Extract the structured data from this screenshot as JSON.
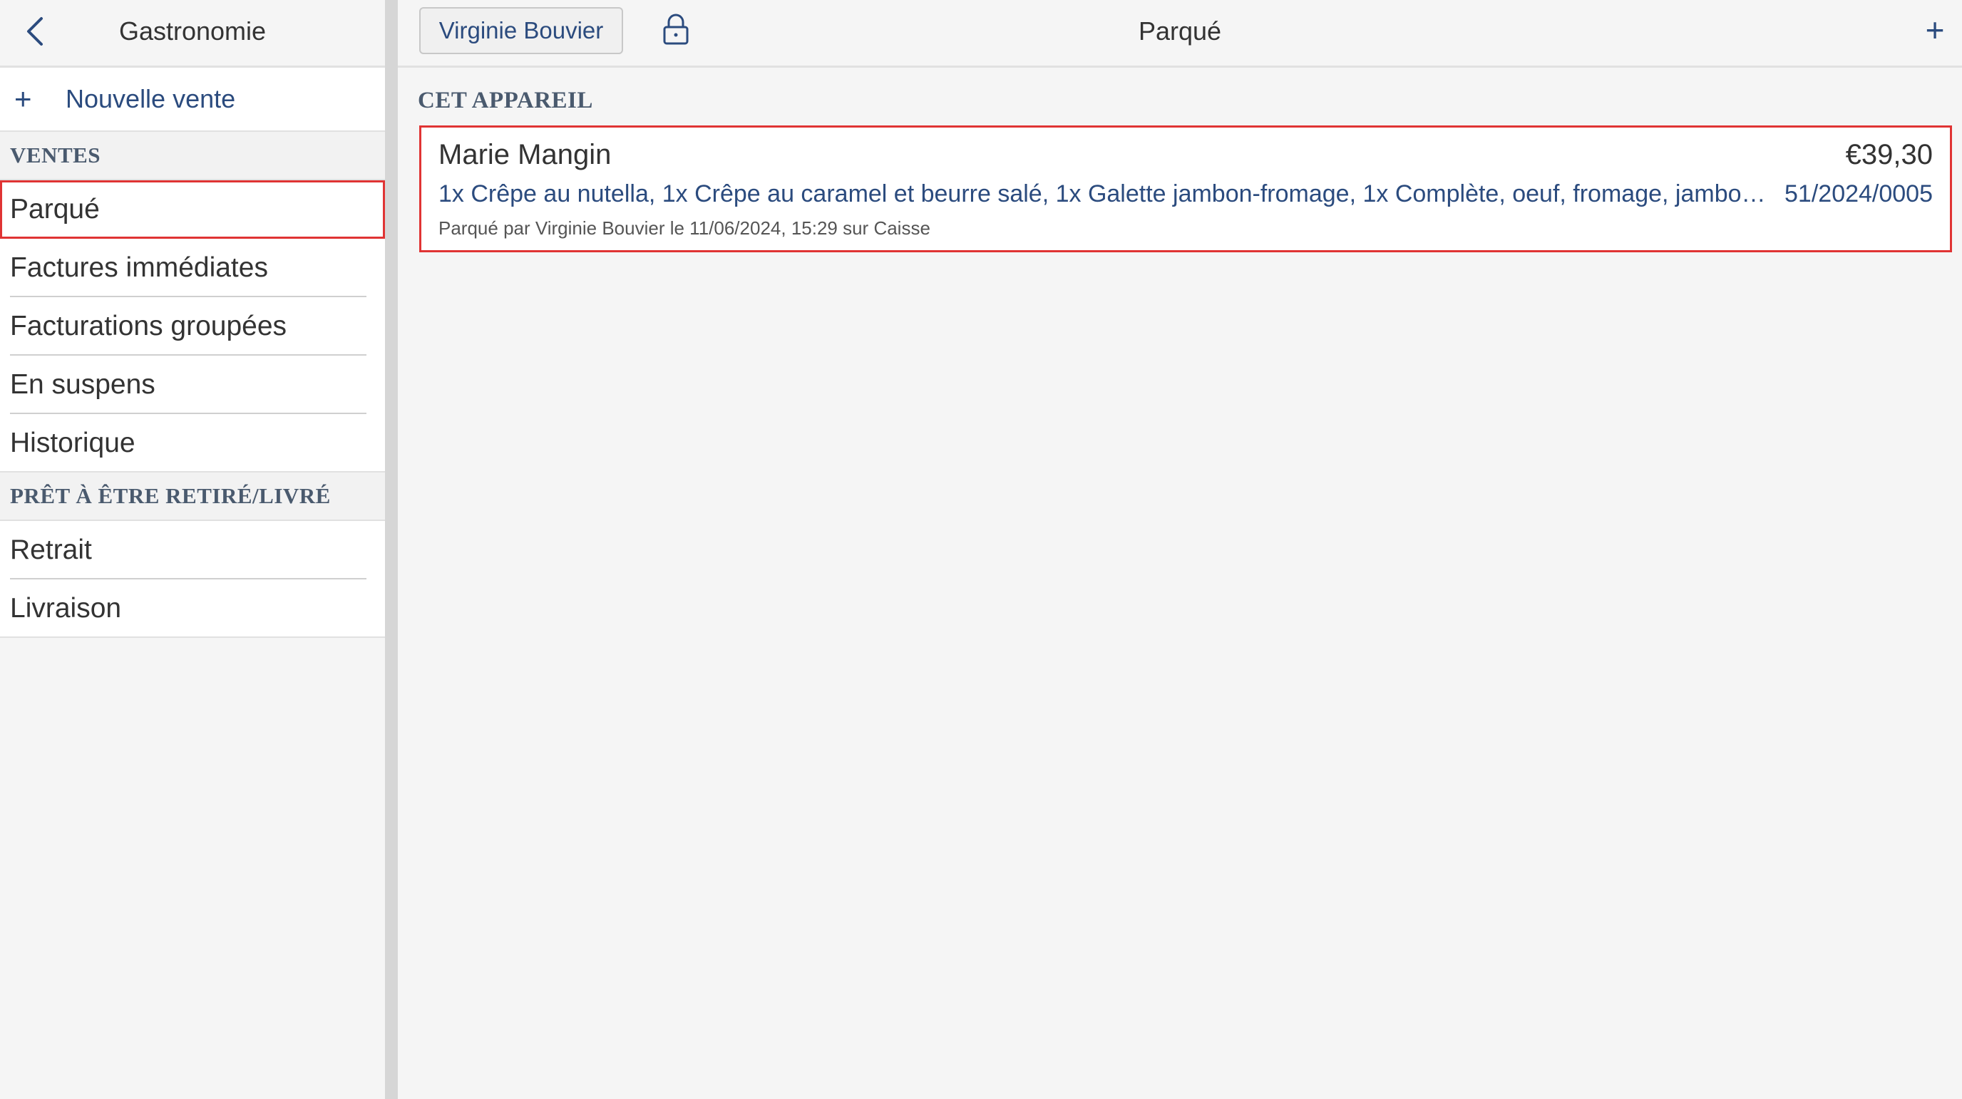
{
  "sidebar": {
    "title": "Gastronomie",
    "new_sale_label": "Nouvelle vente",
    "sections": [
      {
        "header": "VENTES",
        "items": [
          {
            "label": "Parqué",
            "active": true
          },
          {
            "label": "Factures immédiates"
          },
          {
            "label": "Facturations groupées"
          },
          {
            "label": "En suspens"
          },
          {
            "label": "Historique"
          }
        ]
      },
      {
        "header": "PRÊT À ÊTRE RETIRÉ/LIVRÉ",
        "items": [
          {
            "label": "Retrait"
          },
          {
            "label": "Livraison"
          }
        ]
      }
    ]
  },
  "header": {
    "user_label": "Virginie Bouvier",
    "title": "Parqué",
    "lock_icon": "lock-icon",
    "add_icon": "plus-icon"
  },
  "main": {
    "section_header": "CET APPAREIL",
    "sales": [
      {
        "customer": "Marie Mangin",
        "amount": "€39,30",
        "items": "1x Crêpe au nutella, 1x Crêpe au caramel et beurre salé, 1x Galette jambon-fromage, 1x Complète, oeuf, fromage, jambon, ...",
        "reference": "51/2024/0005",
        "meta": "Parqué par Virginie Bouvier le 11/06/2024, 15:29 sur Caisse"
      }
    ]
  },
  "colors": {
    "accent": "#2b4b7e",
    "highlight": "#e03434",
    "background": "#f5f5f5"
  }
}
